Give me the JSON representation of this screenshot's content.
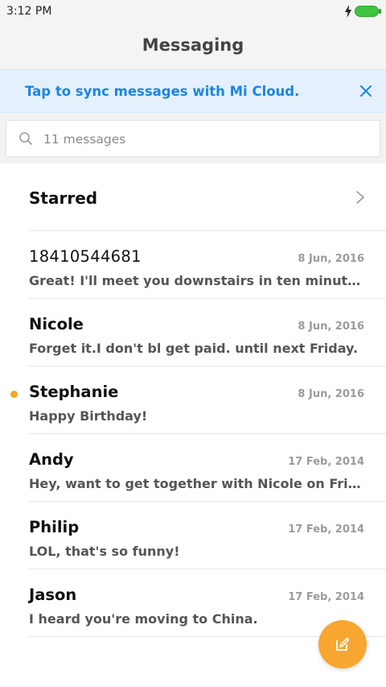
{
  "status_bar": {
    "time": "3:12 PM"
  },
  "header": {
    "title": "Messaging"
  },
  "sync_banner": {
    "text": "Tap to sync messages with Mi Cloud."
  },
  "search": {
    "placeholder": "11 messages"
  },
  "starred": {
    "label": "Starred"
  },
  "messages": [
    {
      "sender": "18410544681",
      "date": "8 Jun, 2016",
      "preview": "Great! I'll meet you downstairs in ten minutes....",
      "unread": false
    },
    {
      "sender": "Nicole",
      "date": "8 Jun, 2016",
      "preview": "Forget it.I don't bl get paid. until next Friday.",
      "unread": false
    },
    {
      "sender": "Stephanie",
      "date": "8 Jun, 2016",
      "preview": "Happy Birthday!",
      "unread": true
    },
    {
      "sender": "Andy",
      "date": "17 Feb, 2014",
      "preview": "Hey, want to get together with Nicole on Frida...",
      "unread": false
    },
    {
      "sender": "Philip",
      "date": "17 Feb, 2014",
      "preview": "LOL, that's so funny!",
      "unread": false
    },
    {
      "sender": "Jason",
      "date": "17 Feb, 2014",
      "preview": "I heard you're moving to China.",
      "unread": false
    }
  ],
  "colors": {
    "accent": "#f7a630",
    "banner_text": "#1a86e3",
    "banner_bg": "#e4f0fb",
    "battery": "#3ec43e",
    "unread_dot": "#f5a623"
  },
  "icons": {
    "bolt": "bolt-icon",
    "battery": "battery-icon",
    "close": "close-icon",
    "search": "search-icon",
    "chevron": "chevron-right-icon",
    "compose": "compose-icon"
  }
}
